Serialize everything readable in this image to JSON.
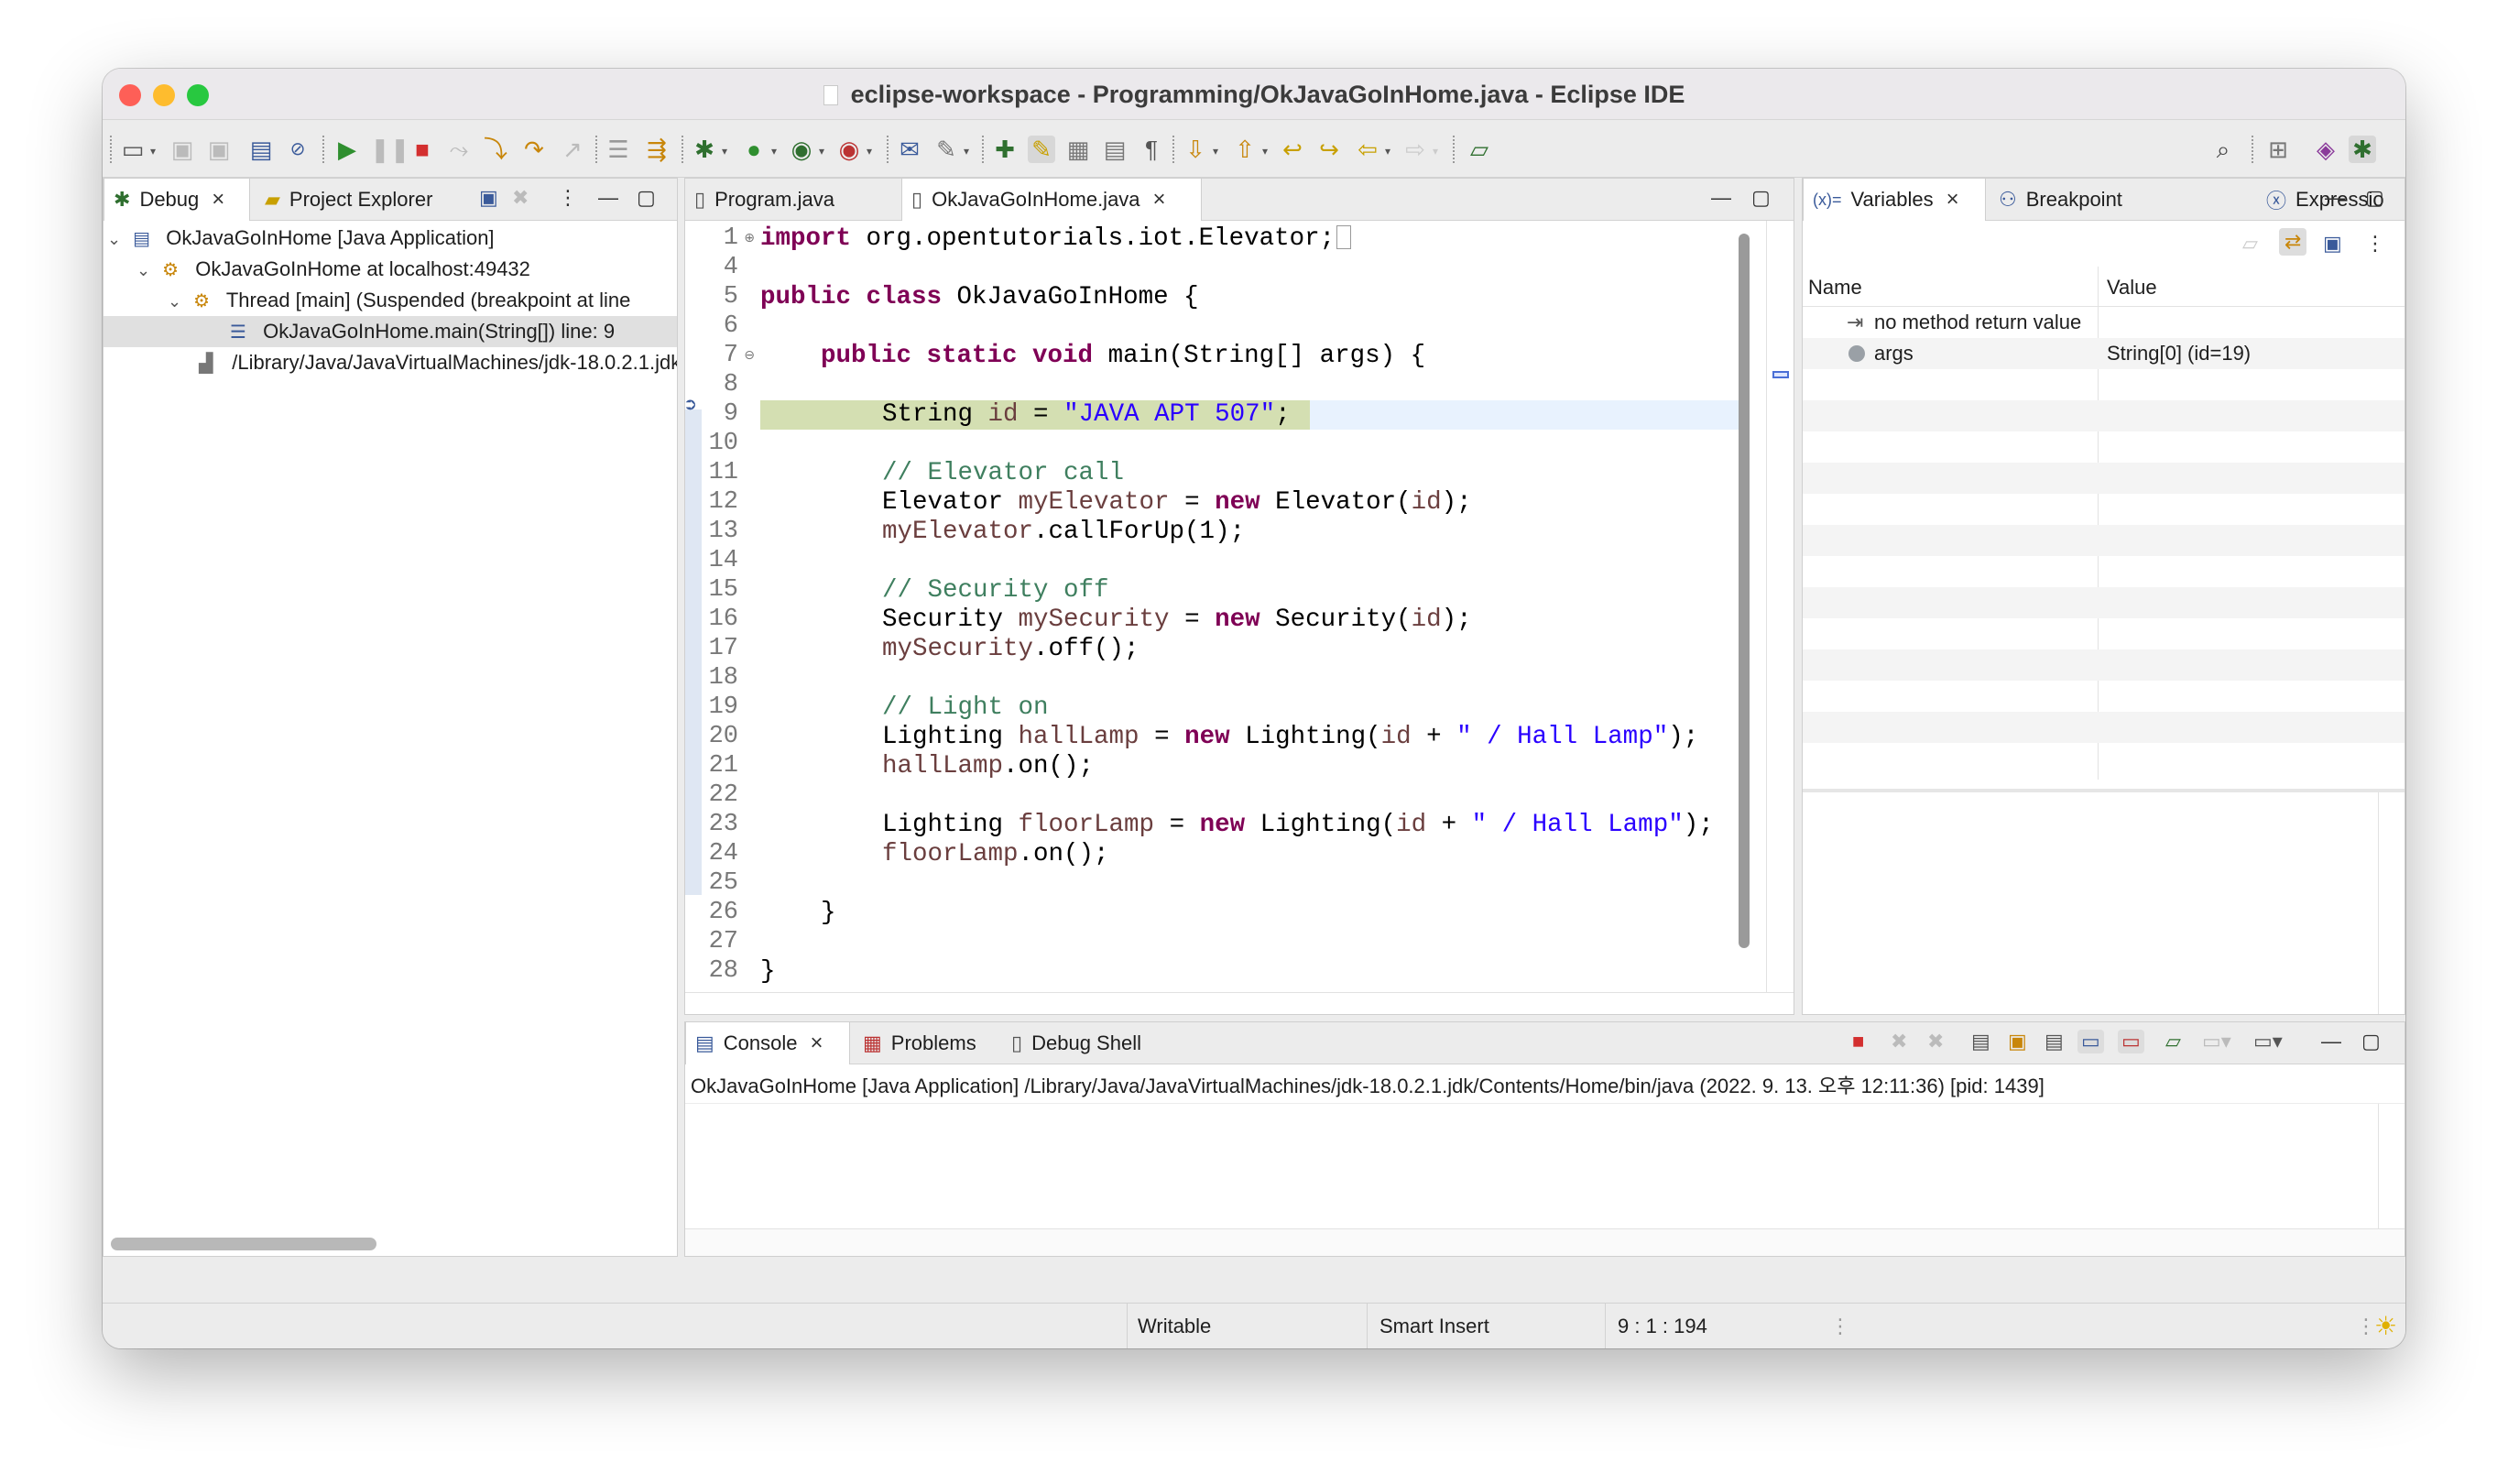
{
  "window": {
    "title": "eclipse-workspace - Programming/OkJavaGoInHome.java - Eclipse IDE"
  },
  "debug_view": {
    "tabs": [
      {
        "label": "Debug",
        "icon": "bug-icon"
      },
      {
        "label": "Project Explorer",
        "icon": "folder-icon"
      }
    ],
    "tree": [
      {
        "label": "OkJavaGoInHome [Java Application]",
        "icon": "java-app-icon"
      },
      {
        "label": "OkJavaGoInHome at localhost:49432",
        "icon": "vm-icon"
      },
      {
        "label": "Thread [main] (Suspended (breakpoint at line",
        "icon": "thread-icon"
      },
      {
        "label": "OkJavaGoInHome.main(String[]) line: 9",
        "icon": "stack-frame-icon"
      },
      {
        "label": "/Library/Java/JavaVirtualMachines/jdk-18.0.2.1.jdk",
        "icon": "process-icon"
      }
    ]
  },
  "editor": {
    "tabs": [
      {
        "label": "Program.java"
      },
      {
        "label": "OkJavaGoInHome.java"
      }
    ],
    "line_numbers": [
      "1",
      "4",
      "5",
      "6",
      "7",
      "8",
      "9",
      "10",
      "11",
      "12",
      "13",
      "14",
      "15",
      "16",
      "17",
      "18",
      "19",
      "20",
      "21",
      "22",
      "23",
      "24",
      "25",
      "26",
      "27",
      "28"
    ],
    "lines": {
      "l1_kw": "import",
      "l1_rest": " org.opentutorials.iot.Elevator;",
      "l5_kw": "public class",
      "l5_rest": " OkJavaGoInHome {",
      "l7_kw": "public static void",
      "l7_rest": " main(String[] args) {",
      "l9_a": "String ",
      "l9_var": "id",
      "l9_b": " = ",
      "l9_str": "\"JAVA APT 507\"",
      "l9_c": ";",
      "l11_cm": "// Elevator call",
      "l12_a": "Elevator ",
      "l12_var": "myElevator",
      "l12_b": " = ",
      "l12_kw": "new",
      "l12_c": " Elevator(",
      "l12_var2": "id",
      "l12_d": ");",
      "l13_var": "myElevator",
      "l13_a": ".callForUp(1);",
      "l15_cm": "// Security off",
      "l16_a": "Security ",
      "l16_var": "mySecurity",
      "l16_b": " = ",
      "l16_kw": "new",
      "l16_c": " Security(",
      "l16_var2": "id",
      "l16_d": ");",
      "l17_var": "mySecurity",
      "l17_a": ".off();",
      "l19_cm": "// Light on",
      "l20_a": "Lighting ",
      "l20_var": "hallLamp",
      "l20_b": " = ",
      "l20_kw": "new",
      "l20_c": " Lighting(",
      "l20_var2": "id",
      "l20_d": " + ",
      "l20_str": "\" / Hall Lamp\"",
      "l20_e": ");",
      "l21_var": "hallLamp",
      "l21_a": ".on();",
      "l23_a": "Lighting ",
      "l23_var": "floorLamp",
      "l23_b": " = ",
      "l23_kw": "new",
      "l23_c": " Lighting(",
      "l23_var2": "id",
      "l23_d": " + ",
      "l23_str": "\" / Hall Lamp\"",
      "l23_e": ");",
      "l24_var": "floorLamp",
      "l24_a": ".on();",
      "l26": "}",
      "l28": "}"
    }
  },
  "variables_view": {
    "tabs": [
      {
        "label": "Variables",
        "icon": "variables-icon",
        "prefix": "(x)="
      },
      {
        "label": "Breakpoint",
        "icon": "breakpoint-icon"
      },
      {
        "label": "Expressio",
        "icon": "expression-icon"
      }
    ],
    "columns": [
      "Name",
      "Value"
    ],
    "rows": [
      {
        "name": "no method return value",
        "value": "",
        "icon": "return-value-icon"
      },
      {
        "name": "args",
        "value": "String[0]  (id=19)",
        "icon": "local-variable-icon"
      }
    ]
  },
  "console_view": {
    "tabs": [
      {
        "label": "Console",
        "icon": "console-icon"
      },
      {
        "label": "Problems",
        "icon": "problems-icon"
      },
      {
        "label": "Debug Shell",
        "icon": "debug-shell-icon"
      }
    ],
    "process_line": "OkJavaGoInHome [Java Application] /Library/Java/JavaVirtualMachines/jdk-18.0.2.1.jdk/Contents/Home/bin/java  (2022. 9. 13. 오후 12:11:36) [pid: 1439]"
  },
  "status_bar": {
    "writable": "Writable",
    "insert_mode": "Smart Insert",
    "position": "9 : 1 : 194"
  },
  "colors": {
    "keyword": "#7f0055",
    "string": "#2a00ff",
    "comment": "#3f7f5f",
    "variable": "#6a3e3e",
    "current_line": "#d4dfb2"
  }
}
